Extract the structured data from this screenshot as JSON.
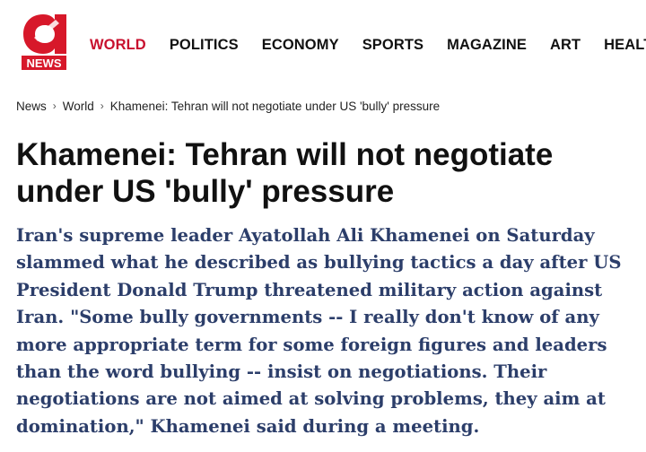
{
  "header": {
    "logo": {
      "icon": "a-news-logo",
      "text": "NEWS",
      "brand_color": "#c8102e"
    },
    "nav": [
      {
        "label": "WORLD",
        "active": true
      },
      {
        "label": "POLITICS"
      },
      {
        "label": "ECONOMY"
      },
      {
        "label": "SPORTS"
      },
      {
        "label": "MAGAZINE"
      },
      {
        "label": "ART"
      },
      {
        "label": "HEALTH"
      }
    ]
  },
  "breadcrumb": {
    "items": [
      "News",
      "World",
      "Khamenei: Tehran will not negotiate under US 'bully' pressure"
    ],
    "separator_icon": "chevron-right-icon"
  },
  "article": {
    "headline": "Khamenei: Tehran will not negotiate under US 'bully' pressure",
    "lead": "Iran's supreme leader Ayatollah Ali Khamenei on Saturday slammed what he described as bullying tactics a day after US President Donald Trump threatened military action against Iran. \"Some bully governments -- I really don't know of any more appropriate term for some foreign figures and leaders than the word bullying -- insist on negotiations. Their negotiations are not aimed at solving problems, they aim at domination,\" Khamenei said during a meeting."
  },
  "colors": {
    "accent": "#c8102e",
    "lead_text": "#2c3e6a",
    "text": "#111111"
  }
}
